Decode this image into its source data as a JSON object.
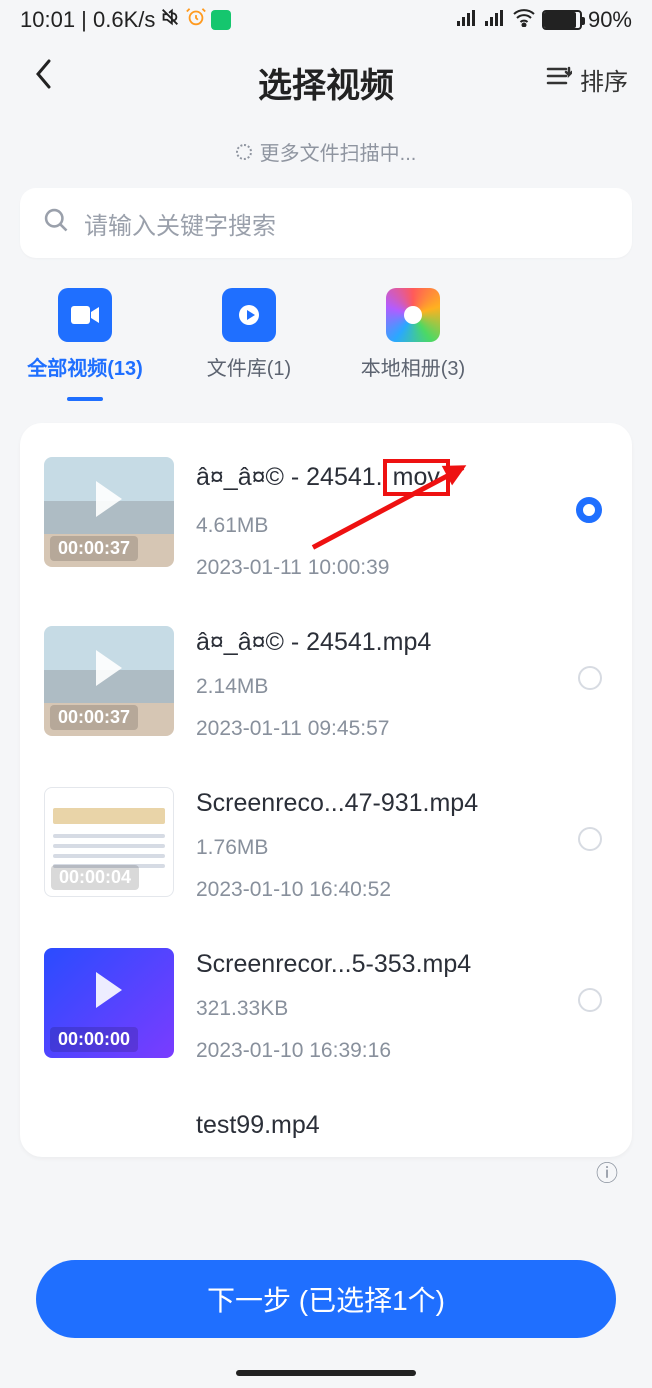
{
  "status": {
    "left": "10:01 | 0.6K/s",
    "battery_pct": "90%"
  },
  "header": {
    "title": "选择视频",
    "sort_label": "排序"
  },
  "scan_msg": "更多文件扫描中...",
  "search": {
    "placeholder": "请输入关键字搜索"
  },
  "tabs": [
    {
      "label": "全部视频(13)"
    },
    {
      "label": "文件库(1)"
    },
    {
      "label": "本地相册(3)"
    }
  ],
  "videos": [
    {
      "name_pre": "â¤_â¤© - 24541.",
      "name_ext": "mov",
      "size": "4.61MB",
      "date": "2023-01-11 10:00:39",
      "dur": "00:00:37",
      "selected": true,
      "highlight": true,
      "thumb": "beach"
    },
    {
      "name": "â¤_â¤© - 24541.mp4",
      "size": "2.14MB",
      "date": "2023-01-11 09:45:57",
      "dur": "00:00:37",
      "selected": false,
      "thumb": "beach"
    },
    {
      "name": "Screenreco...47-931.mp4",
      "size": "1.76MB",
      "date": "2023-01-10 16:40:52",
      "dur": "00:00:04",
      "selected": false,
      "thumb": "screen"
    },
    {
      "name": "Screenrecor...5-353.mp4",
      "size": "321.33KB",
      "date": "2023-01-10 16:39:16",
      "dur": "00:00:00",
      "selected": false,
      "thumb": "screen2"
    },
    {
      "name": "test99.mp4",
      "size": "",
      "date": "",
      "dur": "",
      "selected": false,
      "thumb": "none"
    }
  ],
  "next_button": "下一步 (已选择1个)"
}
